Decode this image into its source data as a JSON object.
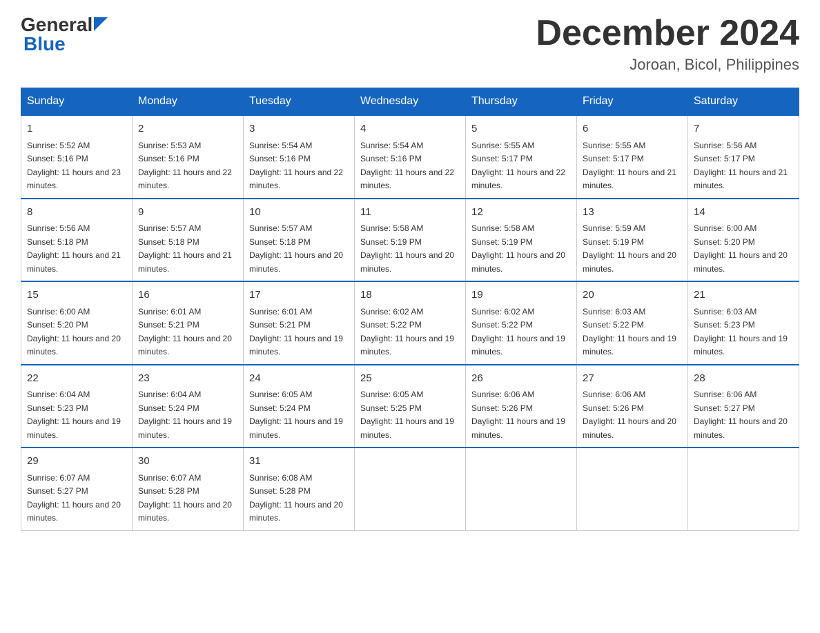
{
  "logo": {
    "text_general": "General",
    "text_blue": "Blue",
    "triangle_alt": "triangle"
  },
  "title": "December 2024",
  "subtitle": "Joroan, Bicol, Philippines",
  "days_of_week": [
    "Sunday",
    "Monday",
    "Tuesday",
    "Wednesday",
    "Thursday",
    "Friday",
    "Saturday"
  ],
  "weeks": [
    [
      {
        "day": "1",
        "sunrise": "5:52 AM",
        "sunset": "5:16 PM",
        "daylight": "11 hours and 23 minutes."
      },
      {
        "day": "2",
        "sunrise": "5:53 AM",
        "sunset": "5:16 PM",
        "daylight": "11 hours and 22 minutes."
      },
      {
        "day": "3",
        "sunrise": "5:54 AM",
        "sunset": "5:16 PM",
        "daylight": "11 hours and 22 minutes."
      },
      {
        "day": "4",
        "sunrise": "5:54 AM",
        "sunset": "5:16 PM",
        "daylight": "11 hours and 22 minutes."
      },
      {
        "day": "5",
        "sunrise": "5:55 AM",
        "sunset": "5:17 PM",
        "daylight": "11 hours and 22 minutes."
      },
      {
        "day": "6",
        "sunrise": "5:55 AM",
        "sunset": "5:17 PM",
        "daylight": "11 hours and 21 minutes."
      },
      {
        "day": "7",
        "sunrise": "5:56 AM",
        "sunset": "5:17 PM",
        "daylight": "11 hours and 21 minutes."
      }
    ],
    [
      {
        "day": "8",
        "sunrise": "5:56 AM",
        "sunset": "5:18 PM",
        "daylight": "11 hours and 21 minutes."
      },
      {
        "day": "9",
        "sunrise": "5:57 AM",
        "sunset": "5:18 PM",
        "daylight": "11 hours and 21 minutes."
      },
      {
        "day": "10",
        "sunrise": "5:57 AM",
        "sunset": "5:18 PM",
        "daylight": "11 hours and 20 minutes."
      },
      {
        "day": "11",
        "sunrise": "5:58 AM",
        "sunset": "5:19 PM",
        "daylight": "11 hours and 20 minutes."
      },
      {
        "day": "12",
        "sunrise": "5:58 AM",
        "sunset": "5:19 PM",
        "daylight": "11 hours and 20 minutes."
      },
      {
        "day": "13",
        "sunrise": "5:59 AM",
        "sunset": "5:19 PM",
        "daylight": "11 hours and 20 minutes."
      },
      {
        "day": "14",
        "sunrise": "6:00 AM",
        "sunset": "5:20 PM",
        "daylight": "11 hours and 20 minutes."
      }
    ],
    [
      {
        "day": "15",
        "sunrise": "6:00 AM",
        "sunset": "5:20 PM",
        "daylight": "11 hours and 20 minutes."
      },
      {
        "day": "16",
        "sunrise": "6:01 AM",
        "sunset": "5:21 PM",
        "daylight": "11 hours and 20 minutes."
      },
      {
        "day": "17",
        "sunrise": "6:01 AM",
        "sunset": "5:21 PM",
        "daylight": "11 hours and 19 minutes."
      },
      {
        "day": "18",
        "sunrise": "6:02 AM",
        "sunset": "5:22 PM",
        "daylight": "11 hours and 19 minutes."
      },
      {
        "day": "19",
        "sunrise": "6:02 AM",
        "sunset": "5:22 PM",
        "daylight": "11 hours and 19 minutes."
      },
      {
        "day": "20",
        "sunrise": "6:03 AM",
        "sunset": "5:22 PM",
        "daylight": "11 hours and 19 minutes."
      },
      {
        "day": "21",
        "sunrise": "6:03 AM",
        "sunset": "5:23 PM",
        "daylight": "11 hours and 19 minutes."
      }
    ],
    [
      {
        "day": "22",
        "sunrise": "6:04 AM",
        "sunset": "5:23 PM",
        "daylight": "11 hours and 19 minutes."
      },
      {
        "day": "23",
        "sunrise": "6:04 AM",
        "sunset": "5:24 PM",
        "daylight": "11 hours and 19 minutes."
      },
      {
        "day": "24",
        "sunrise": "6:05 AM",
        "sunset": "5:24 PM",
        "daylight": "11 hours and 19 minutes."
      },
      {
        "day": "25",
        "sunrise": "6:05 AM",
        "sunset": "5:25 PM",
        "daylight": "11 hours and 19 minutes."
      },
      {
        "day": "26",
        "sunrise": "6:06 AM",
        "sunset": "5:26 PM",
        "daylight": "11 hours and 19 minutes."
      },
      {
        "day": "27",
        "sunrise": "6:06 AM",
        "sunset": "5:26 PM",
        "daylight": "11 hours and 20 minutes."
      },
      {
        "day": "28",
        "sunrise": "6:06 AM",
        "sunset": "5:27 PM",
        "daylight": "11 hours and 20 minutes."
      }
    ],
    [
      {
        "day": "29",
        "sunrise": "6:07 AM",
        "sunset": "5:27 PM",
        "daylight": "11 hours and 20 minutes."
      },
      {
        "day": "30",
        "sunrise": "6:07 AM",
        "sunset": "5:28 PM",
        "daylight": "11 hours and 20 minutes."
      },
      {
        "day": "31",
        "sunrise": "6:08 AM",
        "sunset": "5:28 PM",
        "daylight": "11 hours and 20 minutes."
      },
      null,
      null,
      null,
      null
    ]
  ]
}
